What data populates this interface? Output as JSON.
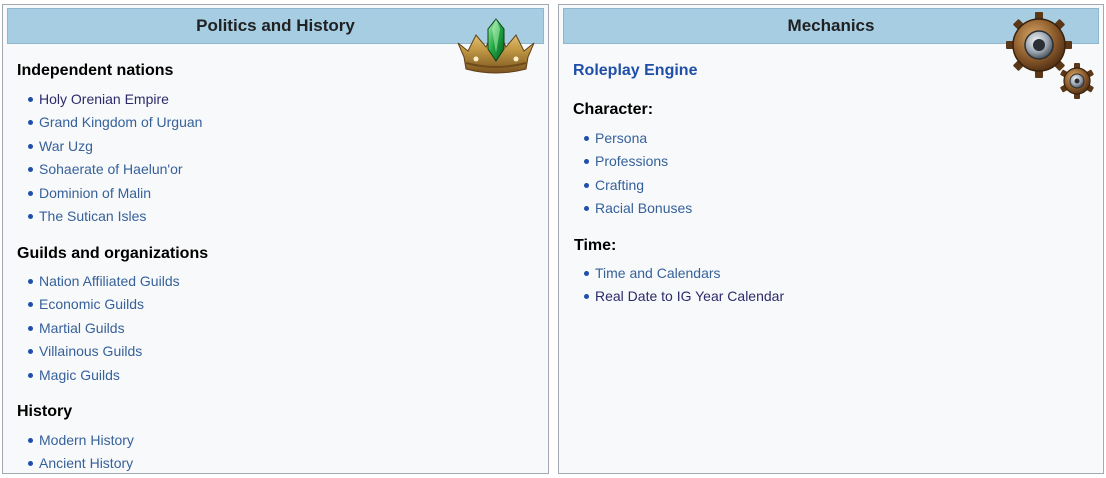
{
  "left": {
    "title": "Politics and History",
    "sections": [
      {
        "heading": "Independent nations",
        "items": [
          {
            "label": "Holy Orenian Empire"
          },
          {
            "label": "Grand Kingdom of Urguan"
          },
          {
            "label": "War Uzg"
          },
          {
            "label": "Sohaerate of Haelun'or"
          },
          {
            "label": "Dominion of Malin"
          },
          {
            "label": "The Sutican Isles"
          }
        ]
      },
      {
        "heading": "Guilds and organizations",
        "items": [
          {
            "label": "Nation Affiliated Guilds"
          },
          {
            "label": "Economic Guilds"
          },
          {
            "label": "Martial Guilds"
          },
          {
            "label": "Villainous Guilds"
          },
          {
            "label": "Magic Guilds"
          }
        ]
      },
      {
        "heading": "History",
        "items": [
          {
            "label": "Modern History"
          },
          {
            "label": "Ancient History"
          }
        ]
      }
    ]
  },
  "right": {
    "title": "Mechanics",
    "engine_link": "Roleplay Engine",
    "sections": [
      {
        "heading": "Character:",
        "items": [
          {
            "label": "Persona"
          },
          {
            "label": "Professions"
          },
          {
            "label": "Crafting"
          },
          {
            "label": "Racial Bonuses"
          }
        ]
      },
      {
        "heading": "Time:",
        "items": [
          {
            "label": "Time and Calendars"
          },
          {
            "label": "Real Date to IG Year Calendar"
          }
        ]
      }
    ]
  },
  "icons": {
    "left_header": "crown-icon",
    "right_header": "gears-icon"
  },
  "colors": {
    "header_bg": "#a7cde2",
    "link": "#36619b",
    "visited_link": "#2d2a6b",
    "panel_bg": "#f8f9fa",
    "border": "#a2a9b1"
  }
}
